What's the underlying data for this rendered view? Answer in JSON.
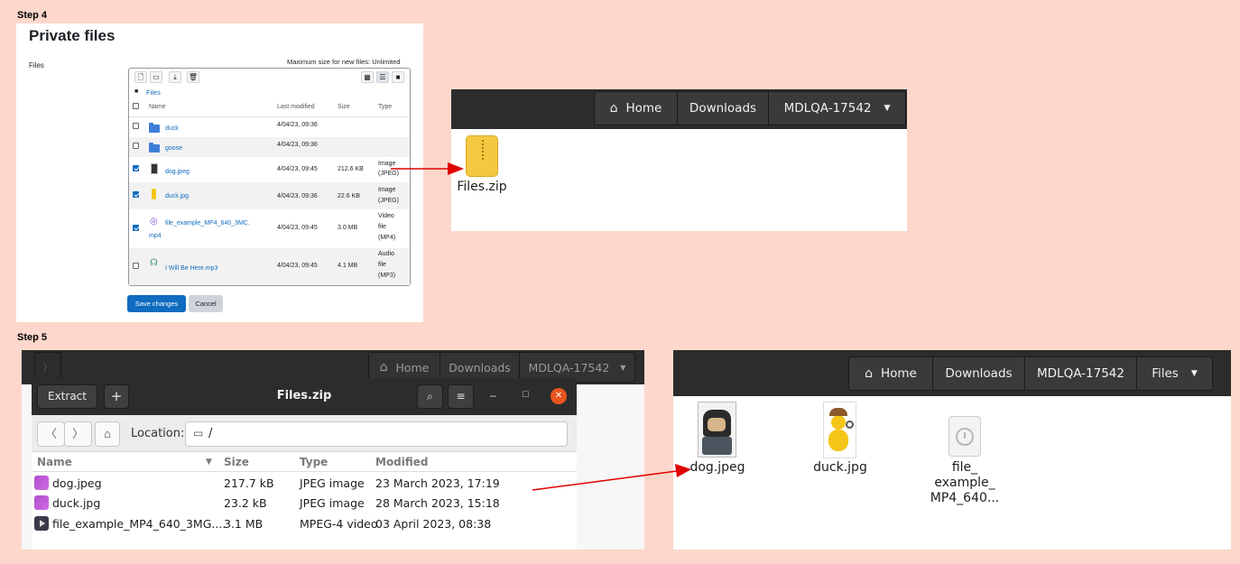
{
  "steps": {
    "step4": "Step 4",
    "step5": "Step 5"
  },
  "moodle": {
    "title": "Private files",
    "files_label": "Files",
    "max_size": "Maximum size for new files: Unlimited",
    "breadcrumb": "Files",
    "columns": {
      "name": "Name",
      "modified": "Last modified",
      "size": "Size",
      "type": "Type"
    },
    "rows": [
      {
        "name": "duck",
        "modified": "4/04/23, 09:36",
        "size": "",
        "type": "",
        "checked": false,
        "kind": "folder"
      },
      {
        "name": "goose",
        "modified": "4/04/23, 09:36",
        "size": "",
        "type": "",
        "checked": false,
        "kind": "folder"
      },
      {
        "name": "dog.jpeg",
        "modified": "4/04/23, 09:45",
        "size": "212.6 KB",
        "type_1": "Image",
        "type_2": "(JPEG)",
        "checked": true,
        "kind": "image"
      },
      {
        "name": "duck.jpg",
        "modified": "4/04/23, 09:36",
        "size": "22.6 KB",
        "type_1": "Image",
        "type_2": "(JPEG)",
        "checked": true,
        "kind": "image"
      },
      {
        "name_1": "file_example_MP4_640_3MC.",
        "name_2": "mp4",
        "modified": "4/04/23, 09:45",
        "size": "3.0 MB",
        "type_1": "Video",
        "type_2": "file",
        "type_3": "(MP4)",
        "checked": true,
        "kind": "video"
      },
      {
        "name": "I Will Be Here.mp3",
        "modified": "4/04/23, 09:45",
        "size": "4.1 MB",
        "type_1": "Audio",
        "type_2": "file",
        "type_3": "(MP3)",
        "checked": false,
        "kind": "audio"
      }
    ],
    "save_label": "Save changes",
    "cancel_label": "Cancel"
  },
  "nautilus_top": {
    "path": [
      "Home",
      "Downloads",
      "MDLQA-17542"
    ],
    "file": "Files.zip"
  },
  "archive": {
    "extract_label": "Extract",
    "add_label": "+",
    "title": "Files.zip",
    "location_label": "Location:",
    "location_value": "/",
    "bg_path": [
      "Home",
      "Downloads",
      "MDLQA-17542"
    ],
    "columns": {
      "name": "Name",
      "size": "Size",
      "type": "Type",
      "modified": "Modified"
    },
    "rows": [
      {
        "name": "dog.jpeg",
        "size": "217.7 kB",
        "type": "JPEG image",
        "modified": "23 March 2023, 17:19",
        "kind": "image"
      },
      {
        "name": "duck.jpg",
        "size": "23.2 kB",
        "type": "JPEG image",
        "modified": "28 March 2023, 15:18",
        "kind": "image"
      },
      {
        "name": "file_example_MP4_640_3MG....",
        "size": "3.1 MB",
        "type": "MPEG-4 video",
        "modified": "03 April 2023, 08:38",
        "kind": "video"
      }
    ]
  },
  "nautilus_bottom": {
    "path": [
      "Home",
      "Downloads",
      "MDLQA-17542",
      "Files"
    ],
    "files": [
      {
        "name": "dog.jpeg"
      },
      {
        "name": "duck.jpg"
      },
      {
        "name_1": "file_",
        "name_2": "example_",
        "name_3": "MP4_640..."
      }
    ]
  },
  "colors": {
    "accent": "#0f6cbf",
    "arrow": "#e00000",
    "background": "#fdd7cb",
    "dark_header": "#2c2c2c",
    "close": "#e95420"
  }
}
